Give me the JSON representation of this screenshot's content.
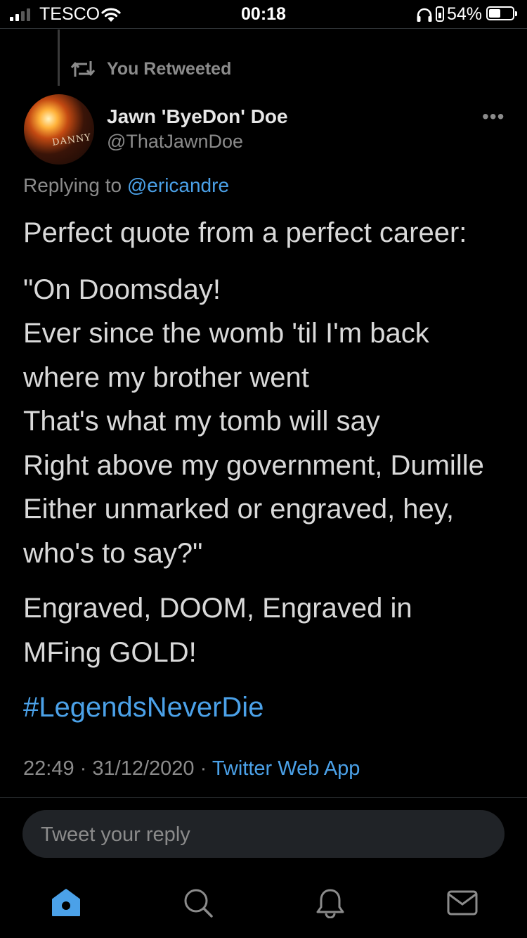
{
  "status_bar": {
    "carrier": "TESCO",
    "time": "00:18",
    "battery_percent": "54%",
    "battery_level": 0.54,
    "signal_bars": 2
  },
  "retweet_context": {
    "label": "You Retweeted",
    "icon": "retweet-icon"
  },
  "author": {
    "name": "Jawn 'ByeDon' Doe",
    "handle": "@ThatJawnDoe",
    "avatar_text": "DANNY"
  },
  "more_label": "•••",
  "reply_to": {
    "prefix": "Replying to",
    "mention": "@ericandre"
  },
  "tweet": {
    "intro": "Perfect quote from a perfect career:",
    "quote_lines": [
      "\"On Doomsday!",
      "Ever since the womb 'til I'm back",
      "where my brother went",
      "That's what my tomb will say",
      "Right above my government, Dumille",
      "Either unmarked or engraved, hey,",
      "who's to say?\""
    ],
    "closing_lines": [
      "Engraved, DOOM, Engraved in",
      "MFing GOLD!"
    ],
    "hashtag": "#LegendsNeverDie"
  },
  "meta": {
    "time": "22:49",
    "date": "31/12/2020",
    "separator": "·",
    "source": "Twitter Web App"
  },
  "reply_box": {
    "placeholder": "Tweet your reply"
  },
  "tab_bar": {
    "items": [
      {
        "name": "home",
        "icon": "home-icon",
        "active": true
      },
      {
        "name": "search",
        "icon": "search-icon",
        "active": false
      },
      {
        "name": "notifications",
        "icon": "bell-icon",
        "active": false
      },
      {
        "name": "messages",
        "icon": "mail-icon",
        "active": false
      }
    ]
  },
  "colors": {
    "background": "#000000",
    "text": "#d9d9d9",
    "muted": "#8b8b8b",
    "accent": "#4ba1e8"
  }
}
